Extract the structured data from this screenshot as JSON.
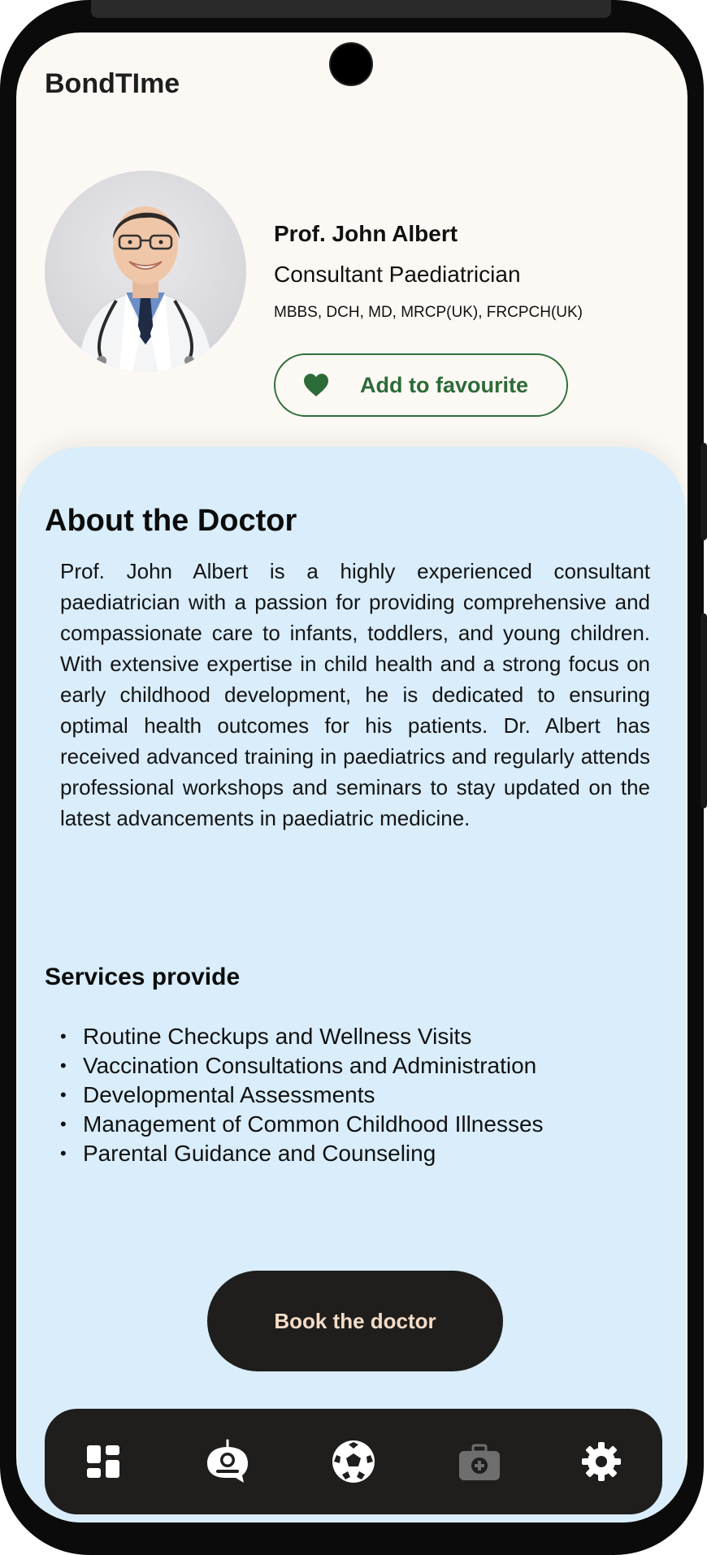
{
  "app": {
    "name": "BondTIme"
  },
  "doctor": {
    "name": "Prof. John Albert",
    "title": "Consultant Paediatrician",
    "qualifications": "MBBS, DCH, MD, MRCP(UK), FRCPCH(UK)",
    "favourite_label": "Add to favourite",
    "accent_color": "#2f6f3a"
  },
  "about": {
    "heading": "About the Doctor",
    "text": "Prof. John Albert is a highly experienced consultant paediatrician with a passion for providing comprehensive and compassionate care to infants, toddlers, and young children. With extensive expertise in child health and a strong focus on early childhood development, he is dedicated to ensuring optimal health outcomes for his patients. Dr. Albert has received advanced training in paediatrics and regularly attends professional workshops and seminars to stay updated on the latest advancements in paediatric medicine."
  },
  "services": {
    "heading": "Services provide",
    "items": [
      "Routine Checkups and Wellness Visits",
      "Vaccination Consultations and Administration",
      "Developmental Assessments",
      "Management of Common Childhood Illnesses",
      "Parental Guidance and Counseling"
    ]
  },
  "booking": {
    "label": "Book the doctor"
  },
  "nav": {
    "items": [
      {
        "icon": "dashboard-icon",
        "active": true
      },
      {
        "icon": "baby-monitor-icon",
        "active": true
      },
      {
        "icon": "football-icon",
        "active": true
      },
      {
        "icon": "medical-kit-icon",
        "active": false
      },
      {
        "icon": "gear-icon",
        "active": true
      }
    ]
  },
  "colors": {
    "panel_background": "#d9edfa",
    "page_background": "#fcf9f5",
    "dark": "#1f1e1c",
    "book_text": "#f5dcc8"
  }
}
